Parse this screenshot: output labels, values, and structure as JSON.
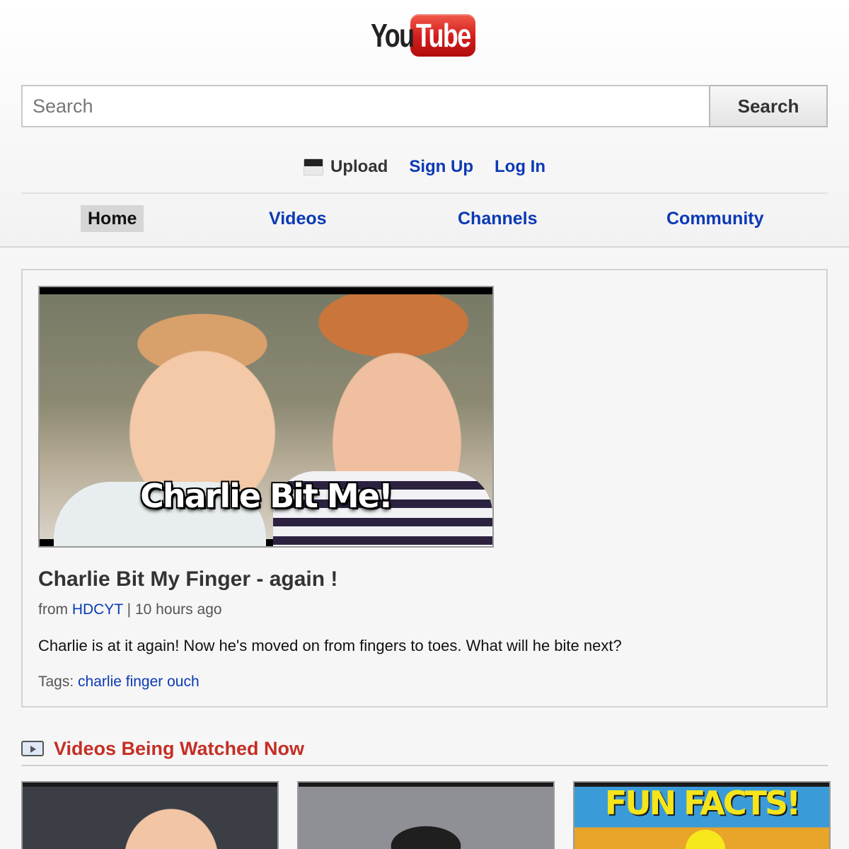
{
  "brand": {
    "you": "You",
    "tube": "Tube"
  },
  "search": {
    "placeholder": "Search",
    "button_label": "Search"
  },
  "user_links": {
    "upload": "Upload",
    "sign_up": "Sign Up",
    "log_in": "Log In"
  },
  "nav": {
    "tabs": [
      {
        "label": "Home",
        "active": true
      },
      {
        "label": "Videos",
        "active": false
      },
      {
        "label": "Channels",
        "active": false
      },
      {
        "label": "Community",
        "active": false
      }
    ]
  },
  "featured": {
    "thumbnail_caption": "Charlie Bit Me!",
    "title": "Charlie Bit My Finger - again !",
    "from_label": "from",
    "channel": "HDCYT",
    "separator": "|",
    "time_ago": "10 hours ago",
    "description": "Charlie is at it again! Now he's moved on from fingers to toes. What will he bite next?",
    "tags_label": "Tags:",
    "tags": "charlie finger ouch"
  },
  "watched_now": {
    "icon": "tv-icon",
    "title": "Videos Being Watched Now",
    "videos": [
      {
        "caption": ""
      },
      {
        "caption": ""
      },
      {
        "caption": "FUN FACTS!"
      }
    ]
  },
  "colors": {
    "brand_red": "#d21c1c",
    "link_blue": "#0b39b5",
    "section_title_red": "#c42f25",
    "page_background": "#f6f6f6"
  }
}
